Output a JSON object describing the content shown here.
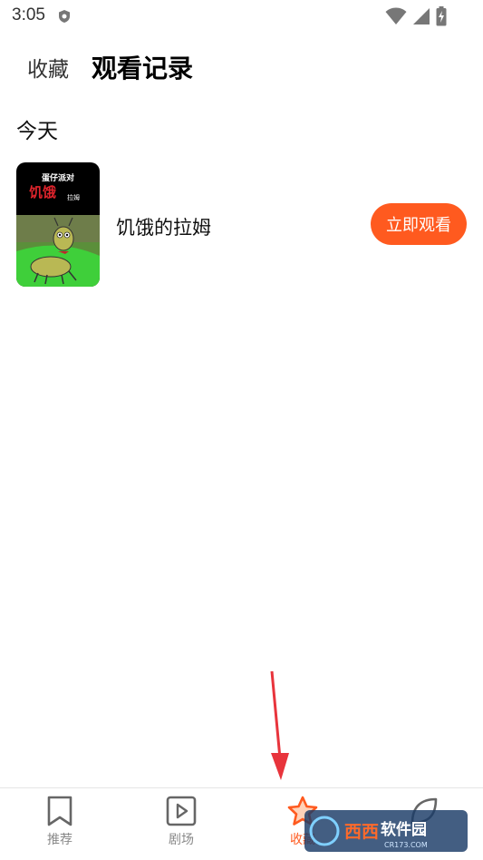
{
  "status_bar": {
    "time": "3:05",
    "icons": [
      "shield-icon",
      "wifi-icon",
      "signal-icon",
      "battery-charging-icon"
    ]
  },
  "header": {
    "tab_favorites": "收藏",
    "tab_history": "观看记录"
  },
  "section": {
    "today_label": "今天"
  },
  "records": [
    {
      "title": "饥饿的拉姆",
      "cover_top_text": "蛋仔派对",
      "cover_title": "饥饿",
      "cover_sub": "拉姆",
      "button_label": "立即观看"
    }
  ],
  "bottom_nav": {
    "items": [
      {
        "label": "推荐",
        "icon": "bookmark-icon",
        "active": false
      },
      {
        "label": "剧场",
        "icon": "play-square-icon",
        "active": false
      },
      {
        "label": "收藏",
        "icon": "star-icon",
        "active": true
      },
      {
        "label": "",
        "icon": "leaf-icon",
        "active": false
      }
    ]
  },
  "colors": {
    "accent": "#ff5a1f",
    "annotation_arrow": "#e8343c"
  },
  "watermark": {
    "text": "西西软件园",
    "sub": "CR173.COM"
  }
}
